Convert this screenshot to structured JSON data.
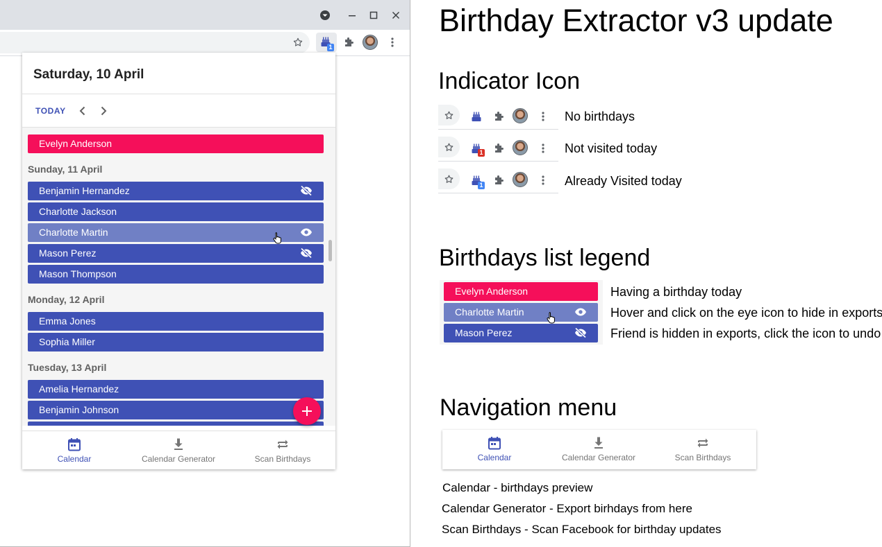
{
  "popup": {
    "date_title": "Saturday, 10 April",
    "today_button": "TODAY",
    "today_chip": "Evelyn Anderson",
    "days": [
      {
        "header": "Sunday, 11 April",
        "friends": [
          "Benjamin Hernandez",
          "Charlotte Jackson",
          "Charlotte Martin",
          "Mason Perez",
          "Mason Thompson"
        ]
      },
      {
        "header": "Monday, 12 April",
        "friends": [
          "Emma Jones",
          "Sophia Miller"
        ]
      },
      {
        "header": "Tuesday, 13 April",
        "friends": [
          "Amelia Hernandez",
          "Benjamin Johnson"
        ]
      }
    ],
    "nav": [
      {
        "label": "Calendar",
        "icon": "calendar-icon",
        "active": true
      },
      {
        "label": "Calendar Generator",
        "icon": "download-icon",
        "active": false
      },
      {
        "label": "Scan Birthdays",
        "icon": "repeat-icon",
        "active": false
      }
    ]
  },
  "browser": {
    "extension_badge": "1"
  },
  "doc": {
    "title": "Birthday Extractor v3 update",
    "indicator_heading": "Indicator Icon",
    "indicator_rows": [
      {
        "label": "No birthdays",
        "badge": ""
      },
      {
        "label": "Not visited today",
        "badge": "1",
        "badge_color": "#d93025"
      },
      {
        "label": "Already Visited today",
        "badge": "1",
        "badge_color": "#4285f4"
      }
    ],
    "legend_heading": "Birthdays list legend",
    "legend": [
      {
        "name": "Evelyn Anderson",
        "desc": "Having a birthday today"
      },
      {
        "name": "Charlotte Martin",
        "desc": "Hover and click on the eye icon to hide in exports"
      },
      {
        "name": "Mason Perez",
        "desc": "Friend is hidden in exports, click the icon to undo"
      }
    ],
    "nav_heading": "Navigation menu",
    "nav_descriptions": [
      "Calendar - birthdays preview",
      "Calendar Generator - Export birhdays from here",
      "Scan Birthdays - Scan Facebook for birthday updates"
    ]
  },
  "colors": {
    "primary": "#3f51b5",
    "today": "#f50f5a",
    "hover": "#7080c5"
  }
}
